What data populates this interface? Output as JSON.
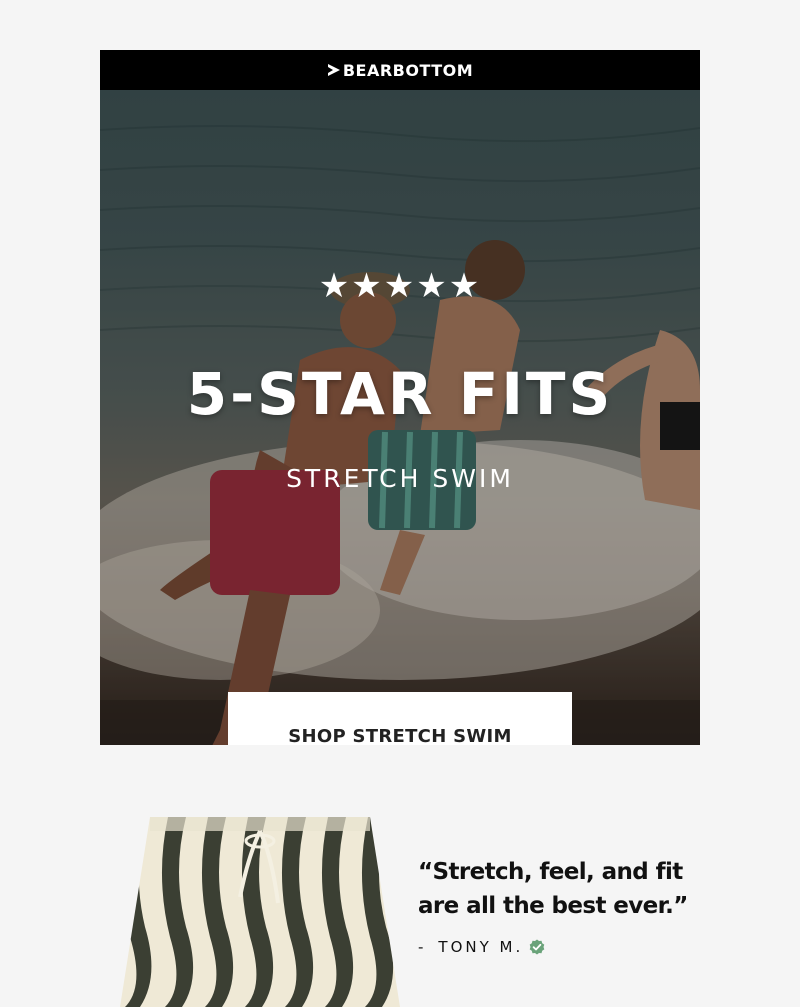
{
  "brand": {
    "name": "BEARBOTTOM"
  },
  "hero": {
    "rating_stars": "★★★★★",
    "rating": 5,
    "title": "5-STAR FITS",
    "subtitle": "STRETCH SWIM",
    "cta_label": "SHOP STRETCH SWIM"
  },
  "review": {
    "quote": "“Stretch, feel, and fit are all the best ever.”",
    "dash": "-",
    "reviewer": "TONY M.",
    "verified_icon": "verified-check-icon",
    "verified_color": "#6aa37a"
  },
  "colors": {
    "brand_bar": "#000000",
    "background": "#f5f5f5",
    "cta_background": "#ffffff",
    "shorts_stripe": "#3b3f33",
    "shorts_base": "#efe9d6"
  }
}
